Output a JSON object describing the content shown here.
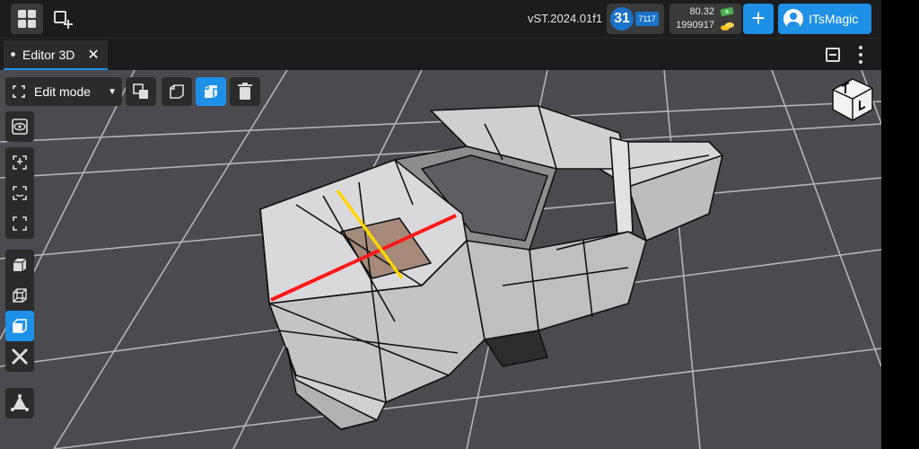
{
  "topbar": {
    "version": "vST.2024.01f1",
    "level": "31",
    "xp": "7117",
    "currency_1": "80.32",
    "currency_2": "1990917",
    "plus_label": "+",
    "user_name": "ITsMagic"
  },
  "tabs": [
    {
      "label": "Editor 3D",
      "close": "✕"
    }
  ],
  "viewport": {
    "mode": "Edit mode",
    "mode_arrow": "▼"
  },
  "colors": {
    "accent": "#1e90e6",
    "panel": "#2b2b2b",
    "viewport_bg": "#4a4a4f",
    "edge_red": "#ff1a1a",
    "edge_yellow": "#ffd400",
    "selected_face": "#a58a7a"
  },
  "icons": {
    "grid": "grid-icon",
    "add_window": "add-window-icon",
    "axis_gizmo": "axis-gizmo-icon"
  }
}
